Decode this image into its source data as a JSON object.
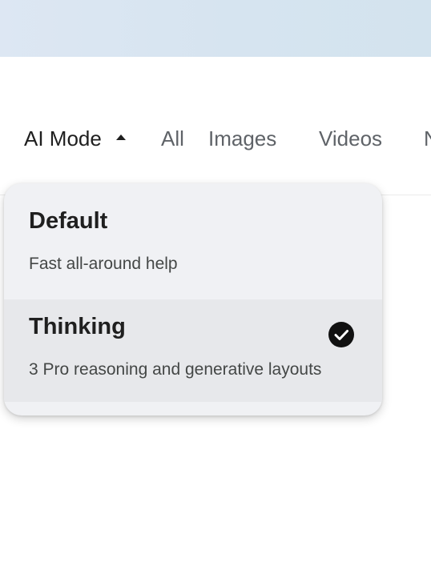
{
  "tabs": {
    "ai_mode": "AI Mode",
    "all": "All",
    "images": "Images",
    "videos": "Videos",
    "more_partial": "N"
  },
  "menu": {
    "items": [
      {
        "title": "Default",
        "description": "Fast all-around help",
        "selected": false
      },
      {
        "title": "Thinking",
        "description": "3 Pro reasoning and generative layouts",
        "selected": true
      }
    ]
  },
  "icons": {
    "caret": "caret-up-icon",
    "check": "check-circle-icon"
  },
  "colors": {
    "banner": "#d6e4f0",
    "menu_background": "#f0f1f4",
    "selected_item": "#e7e8eb",
    "check_fill": "#111111"
  }
}
